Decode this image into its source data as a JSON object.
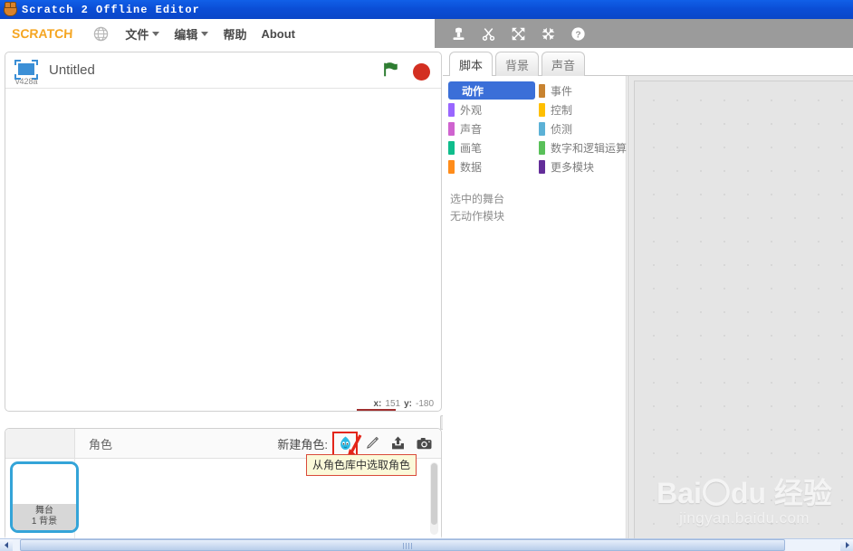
{
  "window": {
    "title": "Scratch 2 Offline Editor",
    "icon": "scratch-cat-icon"
  },
  "menubar": {
    "logo": "SCRATCH",
    "globe_icon": "globe-icon",
    "items": [
      {
        "label": "文件",
        "has_caret": true
      },
      {
        "label": "编辑",
        "has_caret": true
      },
      {
        "label": "帮助",
        "has_caret": false
      },
      {
        "label": "About",
        "has_caret": false
      }
    ],
    "tools": [
      {
        "name": "stamp-icon"
      },
      {
        "name": "scissors-icon"
      },
      {
        "name": "grow-icon"
      },
      {
        "name": "shrink-icon"
      },
      {
        "name": "help-icon"
      }
    ]
  },
  "stage": {
    "project_name": "Untitled",
    "version": "v428a",
    "stage_icon": "stage-thumbnail-icon",
    "green_flag": "green-flag-icon",
    "stop_button": "stop-sign-icon",
    "coords": {
      "x_label": "x:",
      "x_value": "151",
      "y_label": "y:",
      "y_value": "-180"
    }
  },
  "sprite_pane": {
    "header_title": "角色",
    "new_sprite_label": "新建角色:",
    "new_sprite_buttons": [
      {
        "name": "choose-sprite-from-library-icon",
        "highlighted": true
      },
      {
        "name": "paint-new-sprite-icon",
        "highlighted": false
      },
      {
        "name": "upload-sprite-icon",
        "highlighted": false
      },
      {
        "name": "camera-sprite-icon",
        "highlighted": false
      }
    ],
    "stage_item": {
      "title": "舞台",
      "subtitle": "1 背景",
      "selected": true
    },
    "tooltip": "从角色库中选取角色"
  },
  "right_panel": {
    "tabs": [
      {
        "label": "脚本",
        "active": true
      },
      {
        "label": "背景",
        "active": false
      },
      {
        "label": "声音",
        "active": false
      }
    ],
    "categories_left": [
      {
        "label": "动作",
        "color": "#4C97FF",
        "selected": true
      },
      {
        "label": "外观",
        "color": "#9966FF",
        "selected": false
      },
      {
        "label": "声音",
        "color": "#CF63CF",
        "selected": false
      },
      {
        "label": "画笔",
        "color": "#0FBD8C",
        "selected": false
      },
      {
        "label": "数据",
        "color": "#FF8C1A",
        "selected": false
      }
    ],
    "categories_right": [
      {
        "label": "事件",
        "color": "#C88330",
        "selected": false
      },
      {
        "label": "控制",
        "color": "#FFBF00",
        "selected": false
      },
      {
        "label": "侦测",
        "color": "#5CB1D6",
        "selected": false
      },
      {
        "label": "数字和逻辑运算",
        "color": "#59C059",
        "selected": false
      },
      {
        "label": "更多模块",
        "color": "#632D99",
        "selected": false
      }
    ],
    "palette_messages": [
      "选中的舞台",
      "无动作模块"
    ]
  },
  "watermark": {
    "main": "Bai〇du 经验",
    "sub": "jingyan.baidu.com"
  },
  "colors": {
    "titlebar": "#0B4ED6",
    "menubar_gray": "#9B9B9B",
    "selected_category": "#3B6FD8",
    "selection_border": "#34A4D8",
    "tooltip_border": "#D94A3A",
    "tooltip_bg": "#FBF9D9",
    "stop_red": "#D32F21",
    "flag_green": "#2E7D32"
  }
}
